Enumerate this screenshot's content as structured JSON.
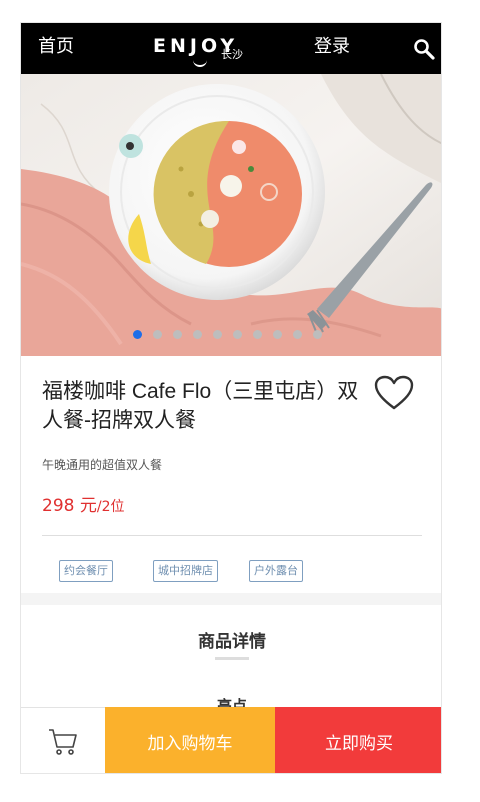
{
  "header": {
    "home_label": "首页",
    "logo_text": "ENJOY",
    "logo_city": "长沙",
    "login_label": "登录",
    "search_icon": "search-icon"
  },
  "carousel": {
    "slide_count": 10,
    "active_index": 0
  },
  "product": {
    "title": "福楼咖啡 Cafe Flo（三里屯店）双人餐-招牌双人餐",
    "subtitle": "午晚通用的超值双人餐",
    "price": "298 元",
    "price_unit": "/2位",
    "tags": [
      "约会餐厅",
      "城中招牌店",
      "户外露台"
    ]
  },
  "details": {
    "section_title": "商品详情",
    "subhead": "亮点"
  },
  "bottom_bar": {
    "cart_icon": "cart-icon",
    "add_to_cart_label": "加入购物车",
    "buy_now_label": "立即购买"
  },
  "colors": {
    "header_bg": "#000000",
    "price": "#e03030",
    "active_dot": "#1e6ee8",
    "add_to_cart": "#fbb12c",
    "buy_now": "#f23b3b",
    "tag_border": "#7f9fc0"
  }
}
